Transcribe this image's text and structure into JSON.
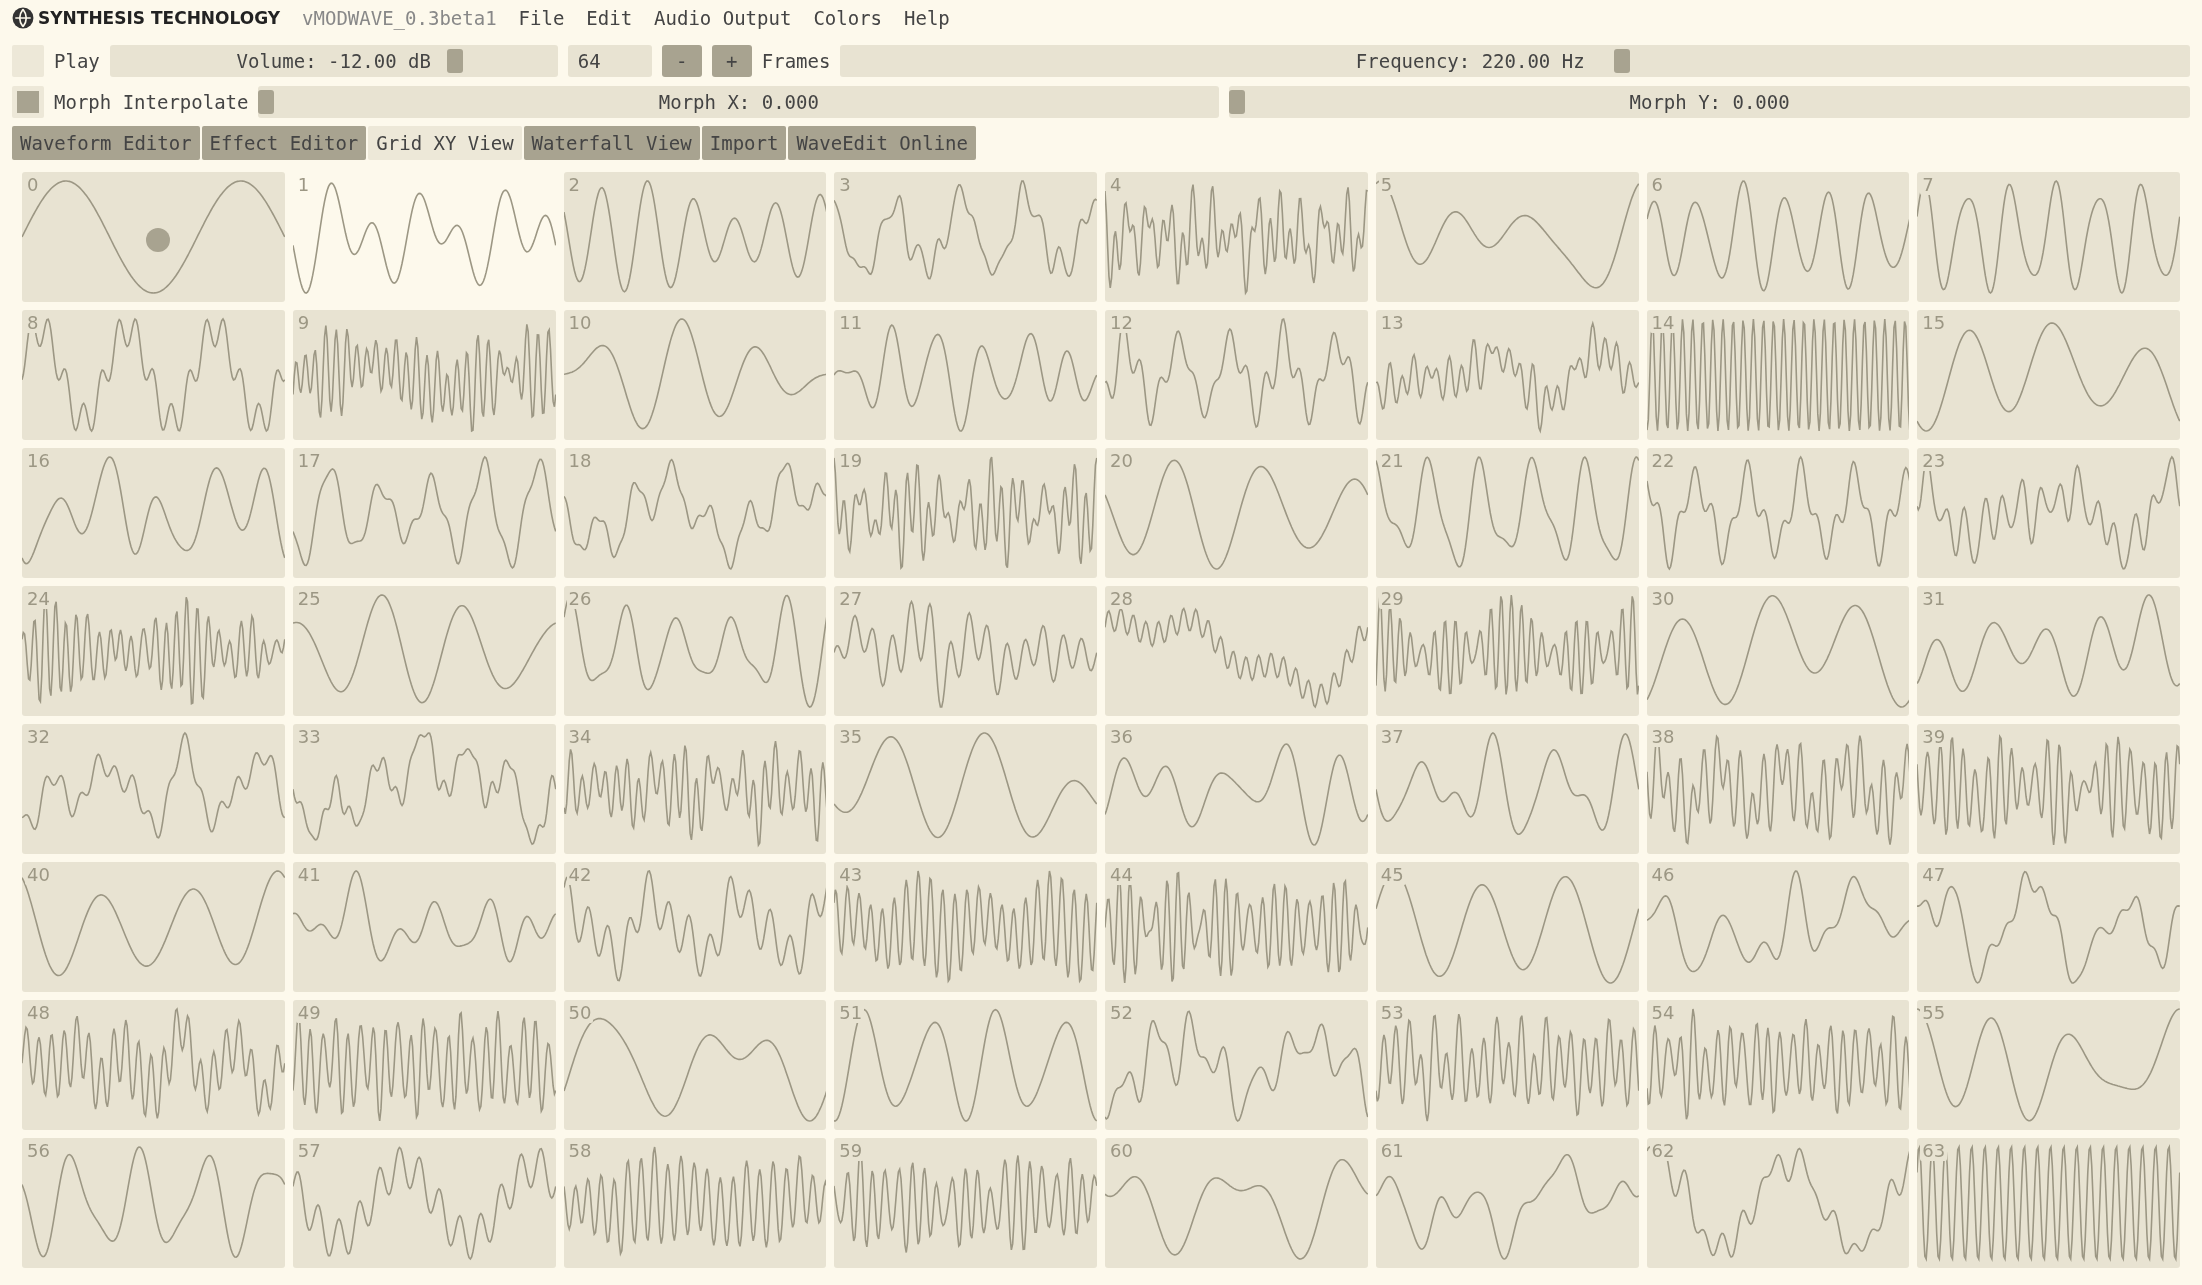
{
  "header": {
    "brand": "SYNTHESIS TECHNOLOGY",
    "version": "vMODWAVE_0.3beta1",
    "menu": [
      "File",
      "Edit",
      "Audio Output",
      "Colors",
      "Help"
    ]
  },
  "controls": {
    "play": {
      "label": "Play",
      "checked": false
    },
    "volume": {
      "label": "Volume: -12.00 dB",
      "level": 0.78
    },
    "frames": {
      "value": "64",
      "decrement": "-",
      "increment": "+",
      "label": "Frames"
    },
    "frequency": {
      "label": "Frequency: 220.00 Hz",
      "level": 0.58
    },
    "morph_interpolate": {
      "label": "Morph Interpolate",
      "checked": true
    },
    "morph_x": {
      "label": "Morph X: 0.000",
      "level": 0
    },
    "morph_y": {
      "label": "Morph Y: 0.000",
      "level": 0
    }
  },
  "tabs": [
    {
      "label": "Waveform Editor",
      "selected": false
    },
    {
      "label": "Effect Editor",
      "selected": false
    },
    {
      "label": "Grid XY View",
      "selected": true
    },
    {
      "label": "Waterfall View",
      "selected": false
    },
    {
      "label": "Import",
      "selected": false
    },
    {
      "label": "WaveEdit Online",
      "selected": false
    }
  ],
  "cells": [
    {
      "label": "0",
      "selected": false,
      "marker": true
    },
    {
      "label": "1",
      "selected": true,
      "marker": false
    },
    {
      "label": "2",
      "selected": false,
      "marker": false
    },
    {
      "label": "3",
      "selected": false,
      "marker": false
    },
    {
      "label": "4",
      "selected": false,
      "marker": false
    },
    {
      "label": "5",
      "selected": false,
      "marker": false
    },
    {
      "label": "6",
      "selected": false,
      "marker": false
    },
    {
      "label": "7",
      "selected": false,
      "marker": false
    },
    {
      "label": "8",
      "selected": false,
      "marker": false
    },
    {
      "label": "9",
      "selected": false,
      "marker": false
    },
    {
      "label": "10",
      "selected": false,
      "marker": false
    },
    {
      "label": "11",
      "selected": false,
      "marker": false
    },
    {
      "label": "12",
      "selected": false,
      "marker": false
    },
    {
      "label": "13",
      "selected": false,
      "marker": false
    },
    {
      "label": "14",
      "selected": false,
      "marker": false
    },
    {
      "label": "15",
      "selected": false,
      "marker": false
    },
    {
      "label": "16",
      "selected": false,
      "marker": false
    },
    {
      "label": "17",
      "selected": false,
      "marker": false
    },
    {
      "label": "18",
      "selected": false,
      "marker": false
    },
    {
      "label": "19",
      "selected": false,
      "marker": false
    },
    {
      "label": "20",
      "selected": false,
      "marker": false
    },
    {
      "label": "21",
      "selected": false,
      "marker": false
    },
    {
      "label": "22",
      "selected": false,
      "marker": false
    },
    {
      "label": "23",
      "selected": false,
      "marker": false
    },
    {
      "label": "24",
      "selected": false,
      "marker": false
    },
    {
      "label": "25",
      "selected": false,
      "marker": false
    },
    {
      "label": "26",
      "selected": false,
      "marker": false
    },
    {
      "label": "27",
      "selected": false,
      "marker": false
    },
    {
      "label": "28",
      "selected": false,
      "marker": false
    },
    {
      "label": "29",
      "selected": false,
      "marker": false
    },
    {
      "label": "30",
      "selected": false,
      "marker": false
    },
    {
      "label": "31",
      "selected": false,
      "marker": false
    },
    {
      "label": "32",
      "selected": false,
      "marker": false
    },
    {
      "label": "33",
      "selected": false,
      "marker": false
    },
    {
      "label": "34",
      "selected": false,
      "marker": false
    },
    {
      "label": "35",
      "selected": false,
      "marker": false
    },
    {
      "label": "36",
      "selected": false,
      "marker": false
    },
    {
      "label": "37",
      "selected": false,
      "marker": false
    },
    {
      "label": "38",
      "selected": false,
      "marker": false
    },
    {
      "label": "39",
      "selected": false,
      "marker": false
    },
    {
      "label": "40",
      "selected": false,
      "marker": false
    },
    {
      "label": "41",
      "selected": false,
      "marker": false
    },
    {
      "label": "42",
      "selected": false,
      "marker": false
    },
    {
      "label": "43",
      "selected": false,
      "marker": false
    },
    {
      "label": "44",
      "selected": false,
      "marker": false
    },
    {
      "label": "45",
      "selected": false,
      "marker": false
    },
    {
      "label": "46",
      "selected": false,
      "marker": false
    },
    {
      "label": "47",
      "selected": false,
      "marker": false
    },
    {
      "label": "48",
      "selected": false,
      "marker": false
    },
    {
      "label": "49",
      "selected": false,
      "marker": false
    },
    {
      "label": "50",
      "selected": false,
      "marker": false
    },
    {
      "label": "51",
      "selected": false,
      "marker": false
    },
    {
      "label": "52",
      "selected": false,
      "marker": false
    },
    {
      "label": "53",
      "selected": false,
      "marker": false
    },
    {
      "label": "54",
      "selected": false,
      "marker": false
    },
    {
      "label": "55",
      "selected": false,
      "marker": false
    },
    {
      "label": "56",
      "selected": false,
      "marker": false
    },
    {
      "label": "57",
      "selected": false,
      "marker": false
    },
    {
      "label": "58",
      "selected": false,
      "marker": false
    },
    {
      "label": "59",
      "selected": false,
      "marker": false
    },
    {
      "label": "60",
      "selected": false,
      "marker": false
    },
    {
      "label": "61",
      "selected": false,
      "marker": false
    },
    {
      "label": "62",
      "selected": false,
      "marker": false
    },
    {
      "label": "63",
      "selected": false,
      "marker": false
    }
  ]
}
